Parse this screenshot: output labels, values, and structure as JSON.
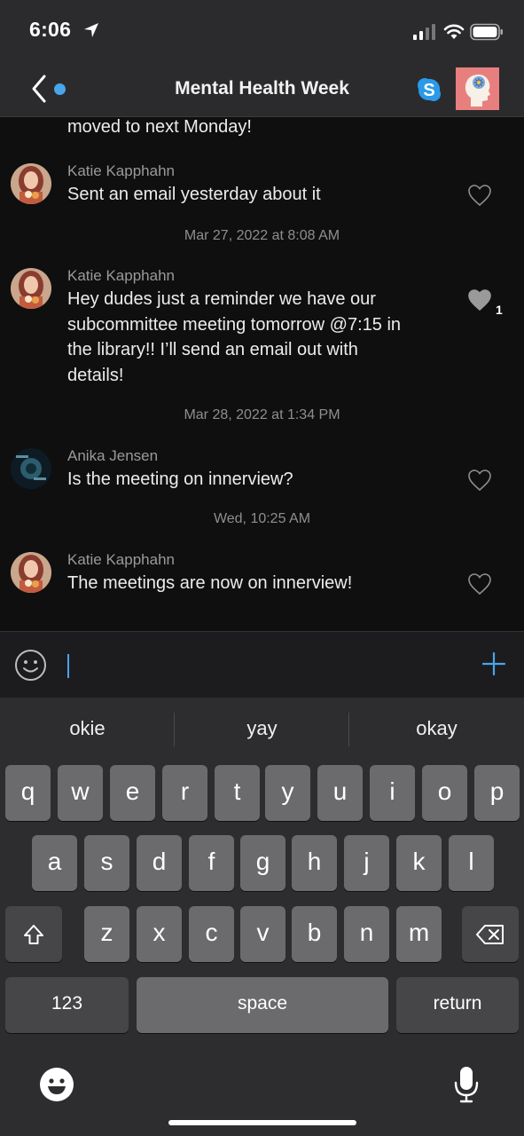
{
  "status_bar": {
    "time": "6:06"
  },
  "nav": {
    "title": "Mental Health Week"
  },
  "chat": {
    "cut_off_text": "moved to next Monday!",
    "messages": [
      {
        "sender": "Katie Kapphahn",
        "text": "Sent an email yesterday about it",
        "likes": ""
      },
      {
        "timestamp": "Mar 27, 2022 at 8:08 AM"
      },
      {
        "sender": "Katie Kapphahn",
        "lines": [
          "Hey dudes just a reminder we have our",
          "subcommittee meeting tomorrow @7:15 in",
          "the library!! I’ll send an email out with",
          "details!"
        ],
        "likes": "1"
      },
      {
        "timestamp": "Mar 28, 2022 at 1:34 PM"
      },
      {
        "sender": "Anika Jensen",
        "text": "Is the meeting on innerview?",
        "likes": ""
      },
      {
        "timestamp": "Wed, 10:25 AM"
      },
      {
        "sender": "Katie Kapphahn",
        "text": "The meetings are now on innerview!",
        "likes": ""
      }
    ]
  },
  "keyboard": {
    "suggestions": [
      "okie",
      "yay",
      "okay"
    ],
    "row1": [
      "q",
      "w",
      "e",
      "r",
      "t",
      "y",
      "u",
      "i",
      "o",
      "p"
    ],
    "row2": [
      "a",
      "s",
      "d",
      "f",
      "g",
      "h",
      "j",
      "k",
      "l"
    ],
    "row3": [
      "z",
      "x",
      "c",
      "v",
      "b",
      "n",
      "m"
    ],
    "numbers_label": "123",
    "space_label": "space",
    "return_label": "return"
  },
  "colors": {
    "accent": "#4aa4ea",
    "key": "#6b6b6d",
    "key_dark": "#464648",
    "background": "#0f0f0f"
  }
}
